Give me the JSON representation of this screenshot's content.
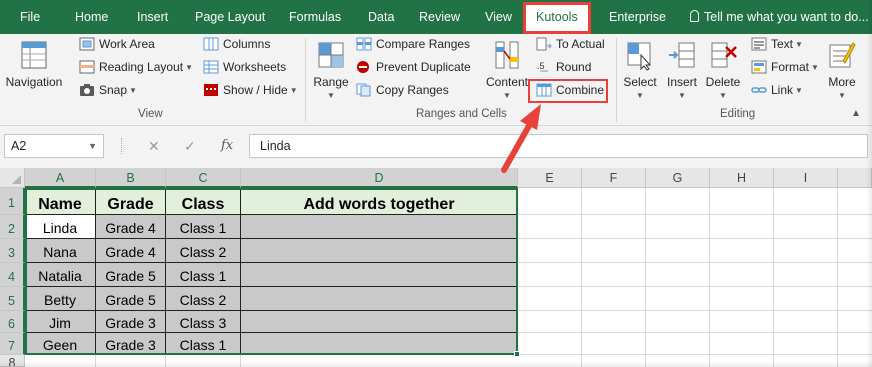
{
  "ribbon_tabs": [
    "File",
    "Home",
    "Insert",
    "Page Layout",
    "Formulas",
    "Data",
    "Review",
    "View",
    "Kutools",
    "Enterprise"
  ],
  "active_tab": "Kutools",
  "tell_me": "Tell me what you want to do...",
  "groups": {
    "view": {
      "label": "View",
      "navigation": "Navigation",
      "work_area": "Work Area",
      "reading_layout": "Reading Layout",
      "snap": "Snap",
      "columns": "Columns",
      "worksheets": "Worksheets",
      "show_hide": "Show / Hide"
    },
    "ranges_cells": {
      "label": "Ranges and Cells",
      "range": "Range",
      "compare_ranges": "Compare Ranges",
      "prevent_duplicate": "Prevent Duplicate",
      "copy_ranges": "Copy Ranges",
      "content": "Content",
      "to_actual": "To Actual",
      "round": "Round",
      "combine": "Combine"
    },
    "editing": {
      "label": "Editing",
      "select": "Select",
      "insert": "Insert",
      "delete": "Delete",
      "text": "Text",
      "format": "Format",
      "link": "Link",
      "more": "More"
    }
  },
  "formula_bar": {
    "name_box": "A2",
    "cancel": "✕",
    "confirm": "✓",
    "fx": "fx",
    "value": "Linda"
  },
  "columns": [
    "A",
    "B",
    "C",
    "D",
    "E",
    "F",
    "G",
    "H",
    "I"
  ],
  "rows": [
    "1",
    "2",
    "3",
    "4",
    "5",
    "6",
    "7",
    "8"
  ],
  "table": {
    "headers": [
      "Name",
      "Grade",
      "Class",
      "Add words together"
    ],
    "rows": [
      [
        "Linda",
        "Grade 4",
        "Class 1",
        ""
      ],
      [
        "Nana",
        "Grade 4",
        "Class 2",
        ""
      ],
      [
        "Natalia",
        "Grade 5",
        "Class 1",
        ""
      ],
      [
        "Betty",
        "Grade 5",
        "Class 2",
        ""
      ],
      [
        "Jim",
        "Grade 3",
        "Class 3",
        ""
      ],
      [
        "Geen",
        "Grade 3",
        "Class 1",
        ""
      ]
    ]
  },
  "colors": {
    "accent": "#217346",
    "highlight": "#e8413b",
    "header_fill": "#e2efda",
    "selection_fill": "#c9c9c9"
  }
}
